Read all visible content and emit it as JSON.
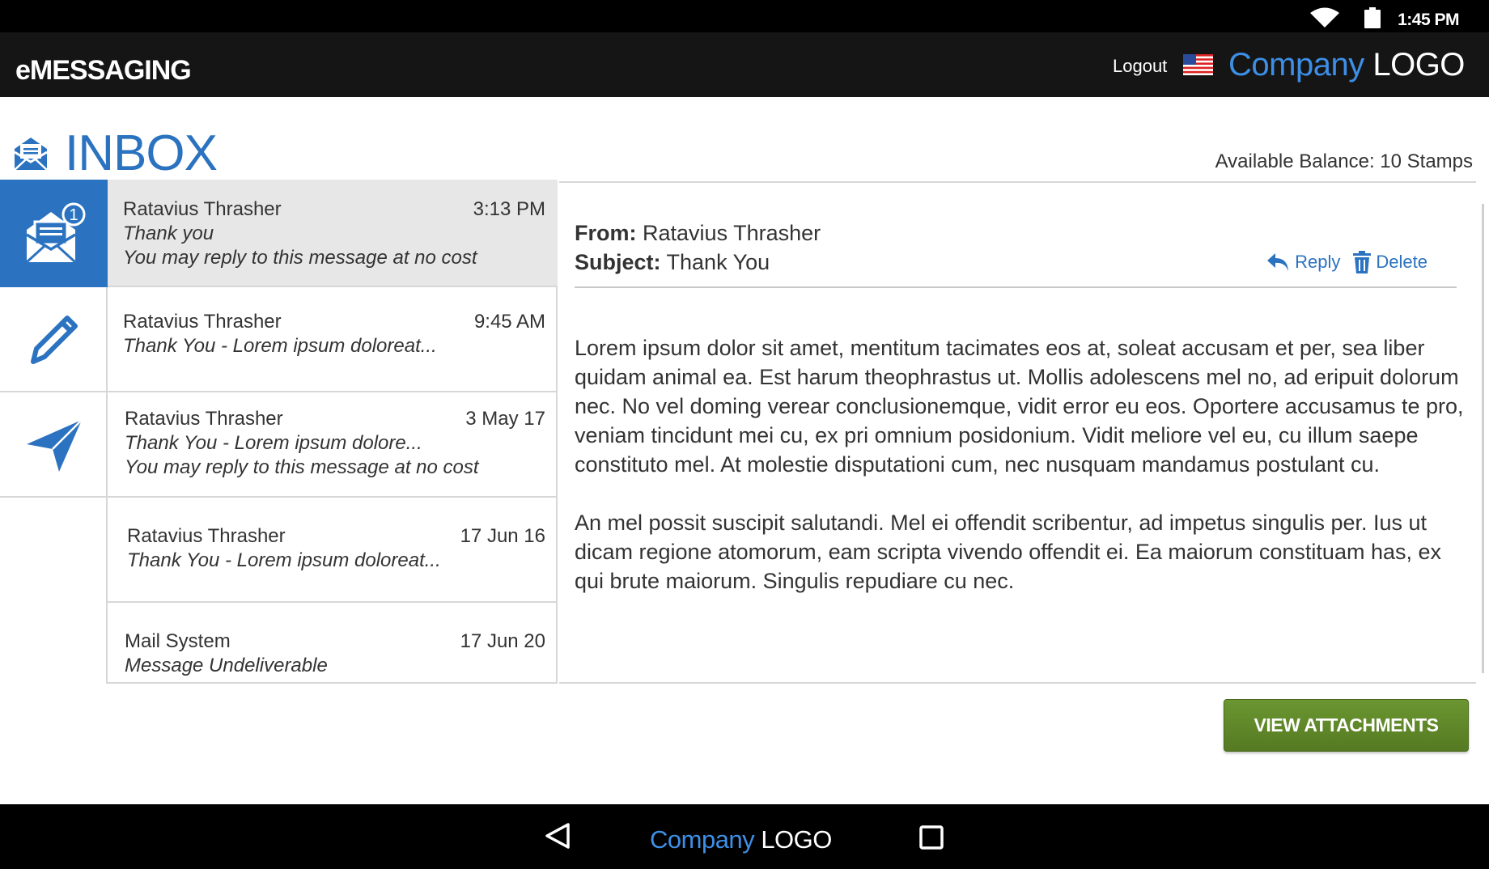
{
  "status": {
    "time": "1:45 PM"
  },
  "header": {
    "app_title": "eMESSAGING",
    "logout_label": "Logout",
    "logo_part1": "Company",
    "logo_part2": "LOGO"
  },
  "inbox": {
    "title": "INBOX",
    "balance": "Available Balance: 10 Stamps",
    "unread_count": "1"
  },
  "messages": [
    {
      "sender": "Ratavius Thrasher",
      "date": "3:13 PM",
      "subject": "Thank you",
      "note": "You may reply to this message at no cost"
    },
    {
      "sender": "Ratavius Thrasher",
      "date": "9:45 AM",
      "subject": "Thank You - Lorem ipsum doloreat...",
      "note": ""
    },
    {
      "sender": "Ratavius Thrasher",
      "date": "3 May 17",
      "subject": "Thank You - Lorem ipsum dolore...",
      "note": "You may reply to this message at no cost"
    },
    {
      "sender": "Ratavius Thrasher",
      "date": "17 Jun 16",
      "subject": "Thank You - Lorem ipsum doloreat...",
      "note": ""
    },
    {
      "sender": "Mail System",
      "date": "17 Jun 20",
      "subject": "Message Undeliverable",
      "note": ""
    }
  ],
  "reader": {
    "from_label": "From:",
    "from_value": "Ratavius Thrasher",
    "subject_label": "Subject:",
    "subject_value": "Thank You",
    "reply_label": "Reply",
    "delete_label": "Delete",
    "paragraph1": "Lorem ipsum dolor sit amet, mentitum tacimates eos at, soleat accusam et per, sea liber quidam animal ea. Est harum theophrastus ut. Mollis adolescens mel no, ad eripuit dolorum nec. No vel doming verear conclusionemque, vidit error eu eos. Oportere accusamus te pro, veniam tincidunt mei cu, ex pri omnium posidonium. Vidit meliore vel eu, cu illum saepe constituto mel. At molestie disputationi cum, nec nusquam mandamus postulant cu.",
    "paragraph2": "An mel possit suscipit salutandi. Mel ei offendit scribentur, ad impetus singulis per. Ius ut dicam regione atomorum, eam scripta vivendo offendit ei. Ea maiorum constituam has, ex qui brute maiorum. Singulis repudiare cu nec."
  },
  "attach_button": "VIEW ATTACHMENTS",
  "icons": {
    "rail": [
      "open-envelope-icon",
      "pencil-icon",
      "paper-plane-icon"
    ],
    "status": [
      "wifi-icon",
      "battery-icon"
    ],
    "nav": [
      "back-icon",
      "recent-apps-icon"
    ]
  },
  "colors": {
    "accent": "#2b73c0",
    "button": "#5f8a2a",
    "bar": "#151515"
  }
}
